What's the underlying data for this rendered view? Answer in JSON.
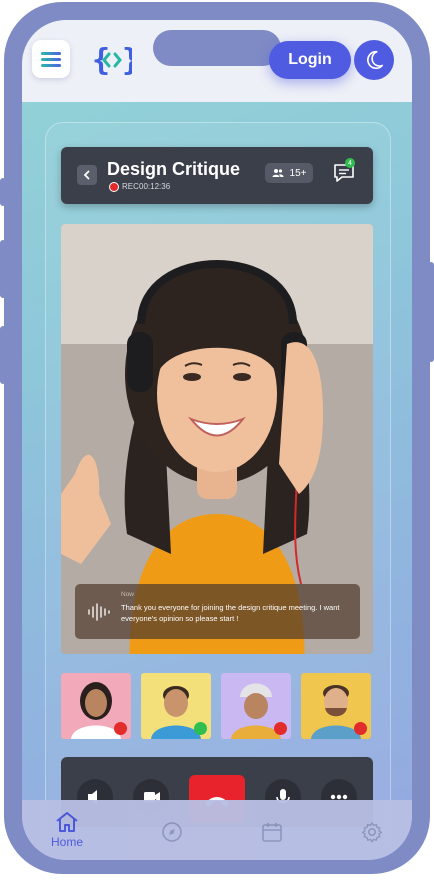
{
  "app": {
    "logo_glyph": "{<>}",
    "login_label": "Login",
    "accent_color": "#4f5be0",
    "frame_color": "#7f8bc4"
  },
  "call": {
    "title": "Design Critique",
    "rec_label": "REC",
    "timer": "00:12:36",
    "participants_count": "15+",
    "chat_badge": "4"
  },
  "caption": {
    "time": "Now",
    "text": "Thank you everyone for joining the design critique meeting. I want everyone's opinion so please start !"
  },
  "thumbnails": [
    {
      "bg": "#f2a9b9",
      "mic": "muted"
    },
    {
      "bg": "#f3e07b",
      "mic": "speaking"
    },
    {
      "bg": "#c9b8f2",
      "mic": "muted"
    },
    {
      "bg": "#f1c64e",
      "mic": "muted"
    }
  ],
  "controls": [
    "speaker-icon",
    "camera-icon",
    "end-call-icon",
    "mic-icon",
    "more-icon"
  ],
  "nav": {
    "home_label": "Home",
    "items": [
      "home-icon",
      "compass-icon",
      "calendar-icon",
      "gear-icon"
    ]
  }
}
